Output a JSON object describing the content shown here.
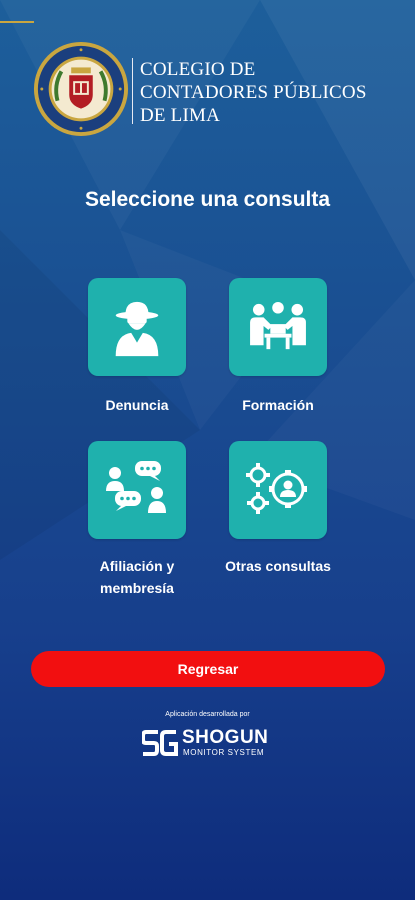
{
  "institution": {
    "name_lines": [
      "COLEGIO DE",
      "CONTADORES PÚBLICOS",
      "DE LIMA"
    ],
    "seal_text": "COLEGIO DE CONTADORES PÚBLICOS DE LIMA",
    "accent_gold": "#c9a640"
  },
  "page": {
    "title": "Seleccione una consulta"
  },
  "options": [
    {
      "label": "Denuncia",
      "icon": "detective-icon"
    },
    {
      "label": "Formación",
      "icon": "team-meeting-icon"
    },
    {
      "label_lines": [
        "Afiliación y",
        "membresía"
      ],
      "icon": "chat-users-icon"
    },
    {
      "label": "Otras consultas",
      "icon": "gears-user-icon"
    }
  ],
  "actions": {
    "back_label": "Regresar",
    "back_color": "#f20f10"
  },
  "footer": {
    "developed_by": "Aplicación desarrollada por",
    "brand_name": "SHOGUN",
    "brand_sub": "MONITOR SYSTEM"
  },
  "colors": {
    "background_top": "#1d5f9b",
    "background_bottom": "#0e2c7c",
    "tile": "#1fb1ad"
  }
}
